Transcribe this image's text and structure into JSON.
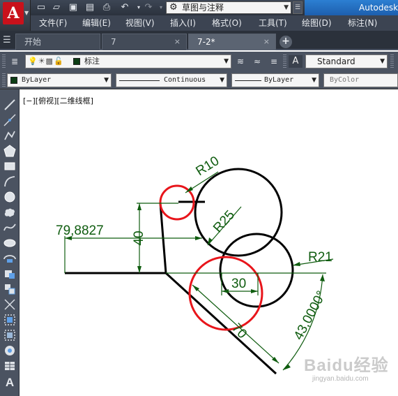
{
  "title_bar": {
    "app_name": "Autodesk",
    "workspace": "草图与注释",
    "logo_letter": "A"
  },
  "quick_access": [
    "new-icon",
    "open-icon",
    "save-icon",
    "save-as-icon",
    "plot-icon",
    "undo-icon",
    "redo-icon"
  ],
  "menu": {
    "items": [
      "文件(F)",
      "编辑(E)",
      "视图(V)",
      "插入(I)",
      "格式(O)",
      "工具(T)",
      "绘图(D)",
      "标注(N)"
    ]
  },
  "file_tabs": {
    "tabs": [
      {
        "label": "开始",
        "active": false
      },
      {
        "label": "7",
        "active": false
      },
      {
        "label": "7-2*",
        "active": true
      }
    ],
    "close_glyph": "×",
    "add_glyph": "+"
  },
  "layer_toolbar": {
    "layer_name": "标注",
    "layer_color": "#0d3d15",
    "text_style": "Standard"
  },
  "properties_toolbar": {
    "color": "ByLayer",
    "linetype": "Continuous",
    "lineweight": "ByLayer",
    "plot_style": "ByColor"
  },
  "canvas": {
    "viewport_label": "[−][俯视][二维线框]",
    "dimension_color": "#0f5c0f",
    "dimensions": {
      "width_dim": "79,8827",
      "height_dim": "40",
      "radius_small": "R10",
      "radius_top": "R25",
      "radius_mid": "R21",
      "length_30": "30",
      "length_70": "70",
      "angle_dim": "43,0000°"
    }
  },
  "watermark": {
    "brand": "Baidu经验",
    "url": "jingyan.baidu.com"
  }
}
